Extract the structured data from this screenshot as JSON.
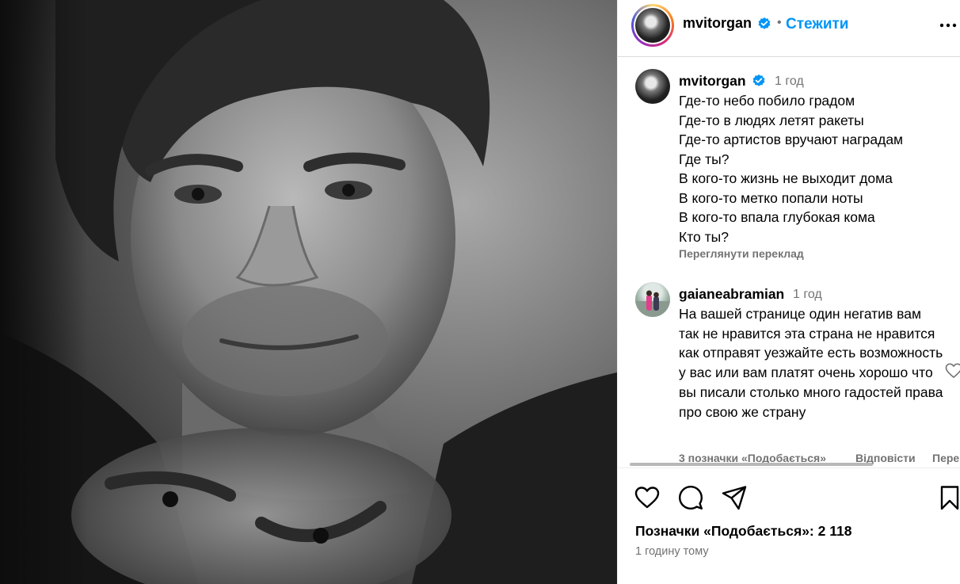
{
  "post": {
    "username": "mvitorgan",
    "separator": "•",
    "follow_label": "Стежити",
    "more_icon": "more-horizontal-icon",
    "verified_icon": "verified-badge-icon"
  },
  "caption": {
    "username": "mvitorgan",
    "time": "1 год",
    "lines": [
      "Где-то небо побило градом",
      "Где-то в людях летят ракеты",
      "Где-то артистов вручают наградам",
      "Где ты?",
      "В кого-то жизнь не выходит дома",
      "В кого-то метко попали ноты",
      "В кого-то впала глубокая кома",
      "Кто ты?"
    ],
    "see_translation": "Переглянути переклад"
  },
  "comments": [
    {
      "username": "gaianeabramian",
      "time": "1 год",
      "text": "На вашей странице один негатив вам так не нравится эта страна не нравится как отправят уезжайте есть возможность у вас или вам платят очень хорошо что вы писали столько много гадостей права про свою же страну",
      "likes_label": "3 позначки «Подобається»",
      "reply_label": "Відповісти",
      "translate_label": "Пере"
    }
  ],
  "actions": {
    "like_icon": "heart-icon",
    "comment_icon": "comment-icon",
    "share_icon": "share-icon",
    "save_icon": "bookmark-icon"
  },
  "likes_text": "Позначки «Подобається»: 2 118",
  "posted_ago": "1 годину тому",
  "colors": {
    "accent": "#0095f6",
    "secondary_text": "#737373",
    "divider": "#dbdbdb"
  }
}
